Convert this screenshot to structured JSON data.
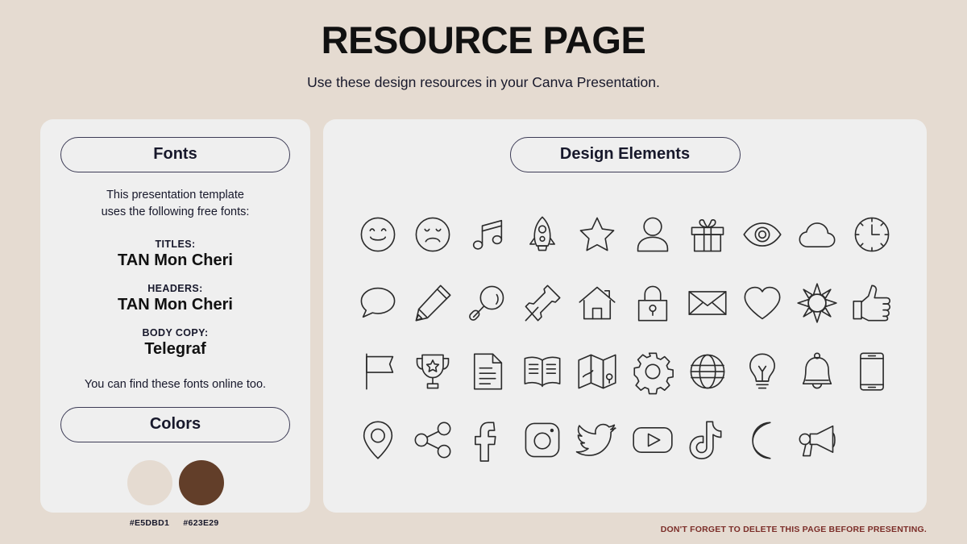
{
  "header": {
    "title": "RESOURCE PAGE",
    "subtitle": "Use these design resources in your Canva Presentation."
  },
  "fonts_panel": {
    "heading": "Fonts",
    "intro_line1": "This presentation template",
    "intro_line2": "uses the following free fonts:",
    "entries": [
      {
        "role": "TITLES:",
        "name": "TAN Mon Cheri"
      },
      {
        "role": "HEADERS:",
        "name": "TAN Mon Cheri"
      },
      {
        "role": "BODY COPY:",
        "name": "Telegraf"
      }
    ],
    "outro": "You can find these fonts online too."
  },
  "colors_panel": {
    "heading": "Colors",
    "swatches": [
      {
        "hex": "#E5DBD1",
        "label": "#E5DBD1"
      },
      {
        "hex": "#623E29",
        "label": "#623E29"
      }
    ]
  },
  "design_panel": {
    "heading": "Design Elements",
    "icons": [
      "smiley-face-icon",
      "sad-face-icon",
      "music-note-icon",
      "rocket-icon",
      "star-icon",
      "person-icon",
      "gift-icon",
      "eye-icon",
      "cloud-icon",
      "clock-icon",
      "speech-bubble-icon",
      "pencil-icon",
      "magnifying-glass-icon",
      "pushpin-icon",
      "house-icon",
      "lock-icon",
      "envelope-icon",
      "heart-icon",
      "sun-icon",
      "thumbs-up-icon",
      "flag-icon",
      "trophy-icon",
      "document-icon",
      "open-book-icon",
      "map-icon",
      "gear-icon",
      "globe-icon",
      "lightbulb-icon",
      "bell-icon",
      "phone-icon",
      "location-pin-icon",
      "share-icon",
      "facebook-icon",
      "instagram-icon",
      "twitter-icon",
      "youtube-icon",
      "tiktok-icon",
      "moon-icon",
      "megaphone-icon"
    ]
  },
  "footer": {
    "note": "DON'T FORGET TO DELETE THIS PAGE BEFORE PRESENTING."
  },
  "theme": {
    "background": "#E5DBD1",
    "panel": "#EFEFEF",
    "ink": "#17182b",
    "footer_red": "#7b2d28"
  }
}
